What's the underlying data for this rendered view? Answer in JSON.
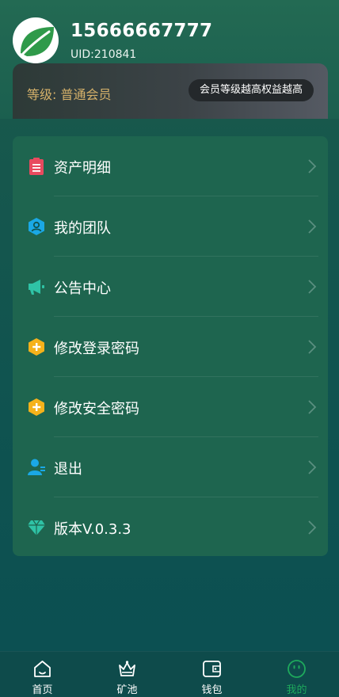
{
  "user": {
    "phone": "15666667777",
    "uid": "UID:210841"
  },
  "level": {
    "label": "等级: 普通会员",
    "badge": "会员等级越高权益越高"
  },
  "menu": [
    {
      "label": "资产明细",
      "icon": "clipboard-icon",
      "color": "#e84a5f"
    },
    {
      "label": "我的团队",
      "icon": "team-icon",
      "color": "#1aa8e6"
    },
    {
      "label": "公告中心",
      "icon": "megaphone-icon",
      "color": "#2fc3a6"
    },
    {
      "label": "修改登录密码",
      "icon": "lock-hexagon-icon",
      "color": "#f5b21b"
    },
    {
      "label": "修改安全密码",
      "icon": "lock-hexagon-icon",
      "color": "#f5b21b"
    },
    {
      "label": "退出",
      "icon": "user-logout-icon",
      "color": "#1aa8e6"
    },
    {
      "label": "版本V.0.3.3",
      "icon": "diamond-icon",
      "color": "#2fc3a6"
    }
  ],
  "tabs": [
    {
      "label": "首页",
      "icon": "home-icon",
      "active": false
    },
    {
      "label": "矿池",
      "icon": "crown-icon",
      "active": false
    },
    {
      "label": "钱包",
      "icon": "wallet-icon",
      "active": false
    },
    {
      "label": "我的",
      "icon": "smile-face-icon",
      "active": true
    }
  ],
  "colors": {
    "active_tab": "#1ea95c",
    "level_gold": "#d6b16a"
  }
}
